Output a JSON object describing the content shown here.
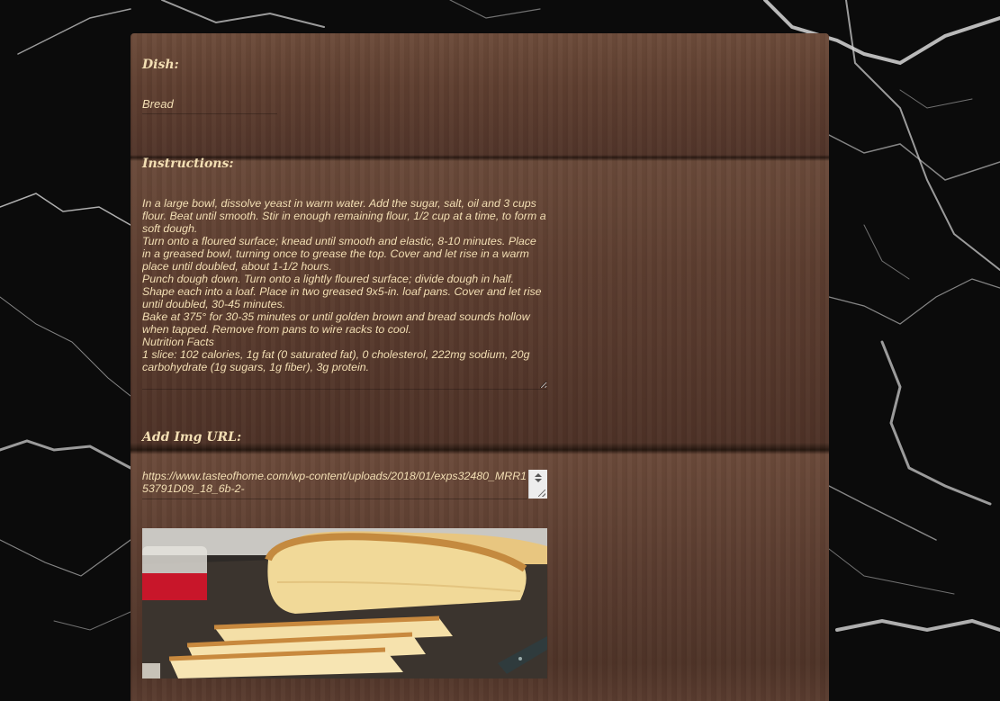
{
  "form": {
    "dish_label": "Dish:",
    "dish_value": "Bread",
    "instructions_label": "Instructions:",
    "instructions_value": "In a large bowl, dissolve yeast in warm water. Add the sugar, salt, oil and 3 cups flour. Beat until smooth. Stir in enough remaining flour, 1/2 cup at a time, to form a soft dough.\nTurn onto a floured surface; knead until smooth and elastic, 8-10 minutes. Place in a greased bowl, turning once to grease the top. Cover and let rise in a warm place until doubled, about 1-1/2 hours.\nPunch dough down. Turn onto a lightly floured surface; divide dough in half. Shape each into a loaf. Place in two greased 9x5-in. loaf pans. Cover and let rise until doubled, 30-45 minutes.\nBake at 375° for 30-35 minutes or until golden brown and bread sounds hollow when tapped. Remove from pans to wire racks to cool.\nNutrition Facts\n1 slice: 102 calories, 1g fat (0 saturated fat), 0 cholesterol, 222mg sodium, 20g carbohydrate (1g sugars, 1g fiber), 3g protein.",
    "img_url_label": "Add Img URL:",
    "img_url_value": "https://www.tasteofhome.com/wp-content/uploads/2018/01/exps32480_MRR153791D09_18_6b-2-"
  },
  "colors": {
    "label_text": "#f3dfb4",
    "wood_base": "#5a3c2f",
    "marble_bg": "#0b0b0b"
  },
  "icons": {
    "scroll_arrows": "scroll-arrows-icon",
    "resize_grip": "resize-grip-icon"
  }
}
